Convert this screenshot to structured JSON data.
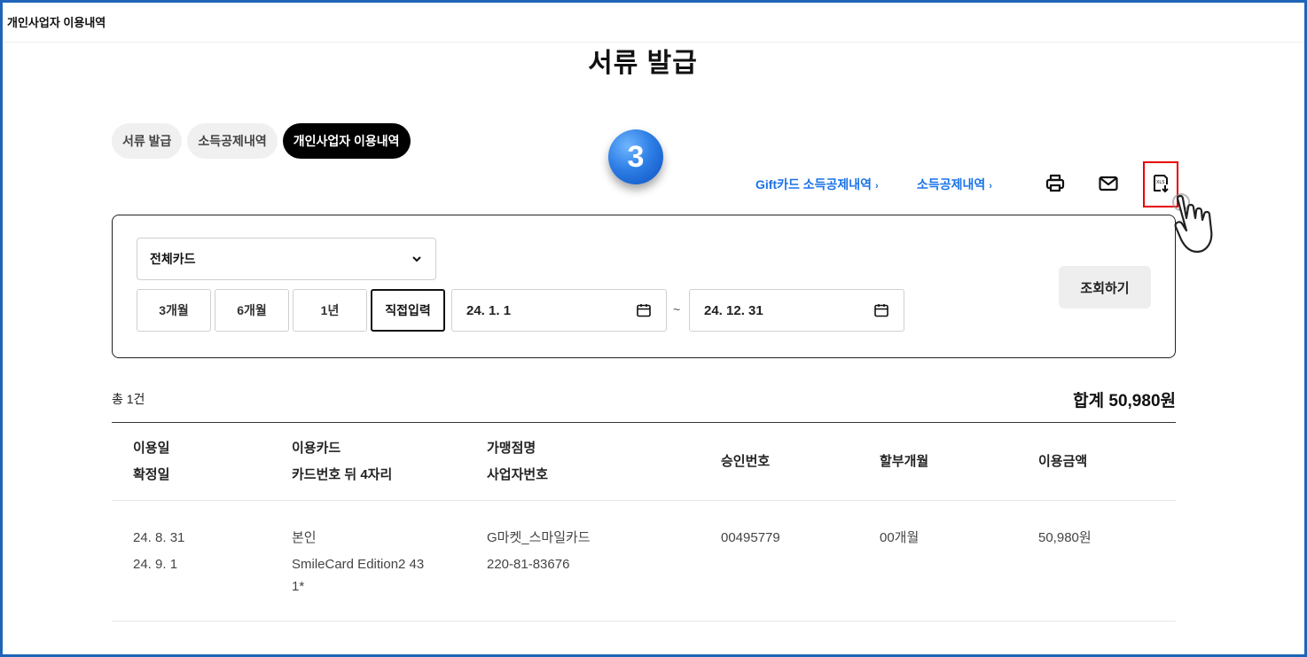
{
  "topbar": {
    "title": "개인사업자 이용내역"
  },
  "page": {
    "title": "서류 발급"
  },
  "tabs": [
    {
      "label": "서류 발급",
      "active": false
    },
    {
      "label": "소득공제내역",
      "active": false
    },
    {
      "label": "개인사업자 이용내역",
      "active": true
    }
  ],
  "step_badge": "3",
  "links": {
    "gift_card": "Gift카드 소득공제내역",
    "income_deduction": "소득공제내역",
    "chevron": "›"
  },
  "actions": {
    "print_icon": "printer-icon",
    "email_icon": "mail-icon",
    "excel_icon": "excel-download-icon"
  },
  "filter": {
    "card_select": "전체카드",
    "periods": [
      "3개월",
      "6개월",
      "1년",
      "직접입력"
    ],
    "active_period": "직접입력",
    "start_date": "24. 1. 1",
    "end_date": "24. 12. 31",
    "separator": "~",
    "search_label": "조회하기"
  },
  "summary": {
    "count": "총 1건",
    "total": "합계 50,980원"
  },
  "table": {
    "headers": [
      {
        "line1": "이용일",
        "line2": "확정일"
      },
      {
        "line1": "이용카드",
        "line2": "카드번호 뒤 4자리"
      },
      {
        "line1": "가맹점명",
        "line2": "사업자번호"
      },
      {
        "line1": "승인번호",
        "line2": ""
      },
      {
        "line1": "할부개월",
        "line2": ""
      },
      {
        "line1": "이용금액",
        "line2": ""
      }
    ],
    "rows": [
      {
        "use_date": "24. 8. 31",
        "confirm_date": "24. 9. 1",
        "card_owner": "본인",
        "card_name_a": "SmileCard Edition2 43",
        "card_name_b": "1*",
        "merchant": "G마켓_스마일카드",
        "business_no": "220-81-83676",
        "approval_no": "00495779",
        "installment": "00개월",
        "amount": "50,980원"
      }
    ]
  },
  "colors": {
    "accent_link": "#1a73e8",
    "highlight": "#e60000",
    "frame": "#1f64b8"
  }
}
